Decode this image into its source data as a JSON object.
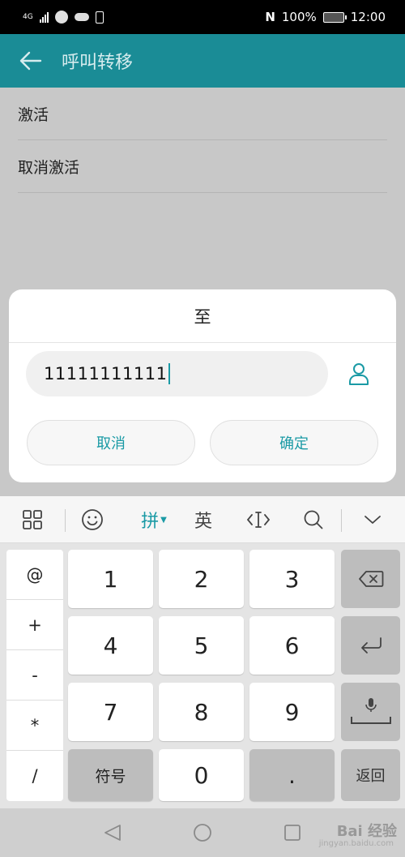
{
  "status_bar": {
    "network": "4G",
    "nfc": "N",
    "battery": "100%",
    "time": "12:00"
  },
  "app_bar": {
    "title": "呼叫转移"
  },
  "list": {
    "items": [
      {
        "label": "激活"
      },
      {
        "label": "取消激活"
      }
    ]
  },
  "dialog": {
    "title": "至",
    "input_value": "11111111111",
    "cancel_label": "取消",
    "confirm_label": "确定"
  },
  "keyboard_toolbar": {
    "pinyin_label": "拼",
    "english_label": "英"
  },
  "keyboard": {
    "symbols": [
      "@",
      "+",
      "-",
      "*",
      "/"
    ],
    "digits": [
      "1",
      "2",
      "3",
      "4",
      "5",
      "6",
      "7",
      "8",
      "9"
    ],
    "symbol_key_label": "符号",
    "zero_label": "0",
    "dot_label": ".",
    "back_key_label": "返回"
  },
  "watermark": {
    "brand": "Bai 经验",
    "url": "jingyan.baidu.com"
  },
  "colors": {
    "accent": "#1a9aa5",
    "app_bar": "#1a8c96"
  }
}
